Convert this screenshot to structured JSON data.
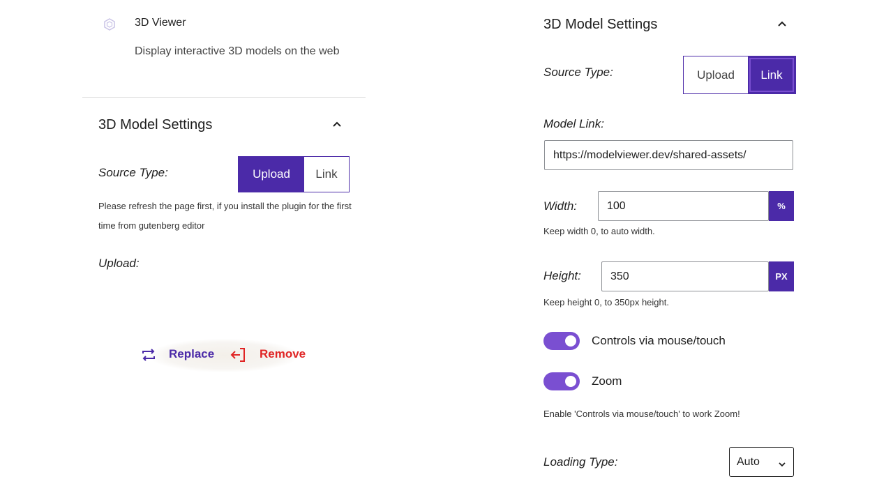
{
  "left": {
    "block": {
      "title": "3D Viewer",
      "description": "Display interactive 3D models on the web"
    },
    "panel": {
      "title": "3D Model Settings",
      "source_label": "Source Type:",
      "source_options": [
        "Upload",
        "Link"
      ],
      "source_selected": "Upload",
      "source_note": "Please refresh the page first, if you install the plugin for the first time from gutenberg editor",
      "upload_label": "Upload:",
      "replace_label": "Replace",
      "remove_label": "Remove"
    }
  },
  "right": {
    "panel": {
      "title": "3D Model Settings",
      "source_label": "Source Type:",
      "source_options": [
        "Upload",
        "Link"
      ],
      "source_selected": "Link",
      "model_link_label": "Model Link:",
      "model_link_value": "https://modelviewer.dev/shared-assets/",
      "width_label": "Width:",
      "width_value": "100",
      "width_unit": "%",
      "width_help": "Keep width 0, to auto width.",
      "height_label": "Height:",
      "height_value": "350",
      "height_unit": "PX",
      "height_help": "Keep height 0, to 350px height.",
      "controls_label": "Controls via mouse/touch",
      "controls_enabled": true,
      "zoom_label": "Zoom",
      "zoom_enabled": true,
      "zoom_help": "Enable 'Controls via mouse/touch' to work Zoom!",
      "loading_label": "Loading Type:",
      "loading_value": "Auto"
    }
  },
  "colors": {
    "accent": "#4b2aa8",
    "toggle": "#7a4fd1",
    "remove": "#e02424"
  },
  "icons": [
    "cube-icon",
    "chevron-up-icon",
    "replace-icon",
    "remove-icon",
    "chevron-down-icon"
  ]
}
